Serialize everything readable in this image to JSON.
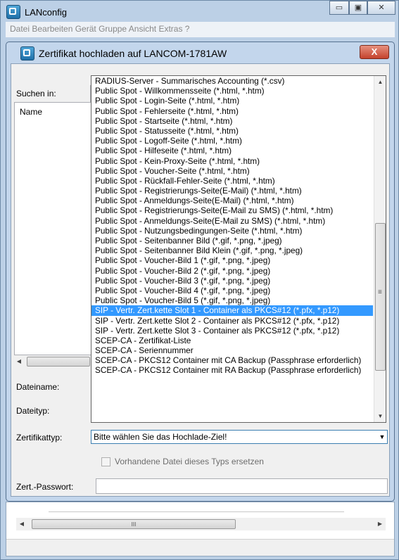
{
  "window": {
    "title": "LANconfig",
    "menu": "Datei  Bearbeiten  Gerät  Gruppe  Ansicht  Extras  ?",
    "minimize_glyph": "▭",
    "maximize_glyph": "▣",
    "close_glyph": "✕",
    "bottom_scroll_thumb": "III"
  },
  "dialog": {
    "title": "Zertifikat hochladen auf LANCOM-1781AW",
    "close_glyph": "X",
    "search_label": "Suchen in:",
    "name_header": "Name",
    "filename_label": "Dateiname:",
    "filetype_label": "Dateityp:",
    "cert_type_label": "Zertifikattyp:",
    "cert_type_value": "Bitte wählen Sie das Hochlade-Ziel!",
    "replace_label": "Vorhandene Datei dieses Typs ersetzen",
    "password_label": "Zert.-Passwort:"
  },
  "dropdown": {
    "items": [
      "RADIUS-Server - Summarisches Accounting (*.csv)",
      "Public Spot - Willkommensseite (*.html, *.htm)",
      "Public Spot - Login-Seite (*.html, *.htm)",
      "Public Spot - Fehlerseite (*.html, *.htm)",
      "Public Spot - Startseite (*.html, *.htm)",
      "Public Spot - Statusseite (*.html, *.htm)",
      "Public Spot - Logoff-Seite (*.html, *.htm)",
      "Public Spot - Hilfeseite (*.html, *.htm)",
      "Public Spot - Kein-Proxy-Seite (*.html, *.htm)",
      "Public Spot - Voucher-Seite (*.html, *.htm)",
      "Public Spot - Rückfall-Fehler-Seite (*.html, *.htm)",
      "Public Spot - Registrierungs-Seite(E-Mail) (*.html, *.htm)",
      "Public Spot - Anmeldungs-Seite(E-Mail) (*.html, *.htm)",
      "Public Spot - Registrierungs-Seite(E-Mail zu SMS) (*.html, *.htm)",
      "Public Spot - Anmeldungs-Seite(E-Mail zu SMS) (*.html, *.htm)",
      "Public Spot - Nutzungsbedingungen-Seite (*.html, *.htm)",
      "Public Spot - Seitenbanner Bild (*.gif, *.png, *.jpeg)",
      "Public Spot - Seitenbanner Bild Klein (*.gif, *.png, *.jpeg)",
      "Public Spot - Voucher-Bild 1 (*.gif, *.png, *.jpeg)",
      "Public Spot - Voucher-Bild 2 (*.gif, *.png, *.jpeg)",
      "Public Spot - Voucher-Bild 3 (*.gif, *.png, *.jpeg)",
      "Public Spot - Voucher-Bild 4 (*.gif, *.png, *.jpeg)",
      "Public Spot - Voucher-Bild 5 (*.gif, *.png, *.jpeg)",
      "SIP - Vertr. Zert.kette Slot 1 - Container als PKCS#12 (*.pfx, *.p12)",
      "SIP - Vertr. Zert.kette Slot 2 - Container als PKCS#12 (*.pfx, *.p12)",
      "SIP - Vertr. Zert.kette Slot 3 - Container als PKCS#12 (*.pfx, *.p12)",
      "SCEP-CA - Zertifikat-Liste",
      "SCEP-CA - Seriennummer",
      "SCEP-CA - PKCS12 Container mit CA Backup (Passphrase erforderlich)",
      "SCEP-CA - PKCS12 Container mit RA Backup (Passphrase erforderlich)"
    ],
    "selected_index": 23,
    "thumb_grip": "≡"
  },
  "icons": {
    "scroll_up": "▲",
    "scroll_down": "▼",
    "scroll_left": "◀",
    "scroll_right": "▶",
    "combo_arrow": "▼"
  }
}
